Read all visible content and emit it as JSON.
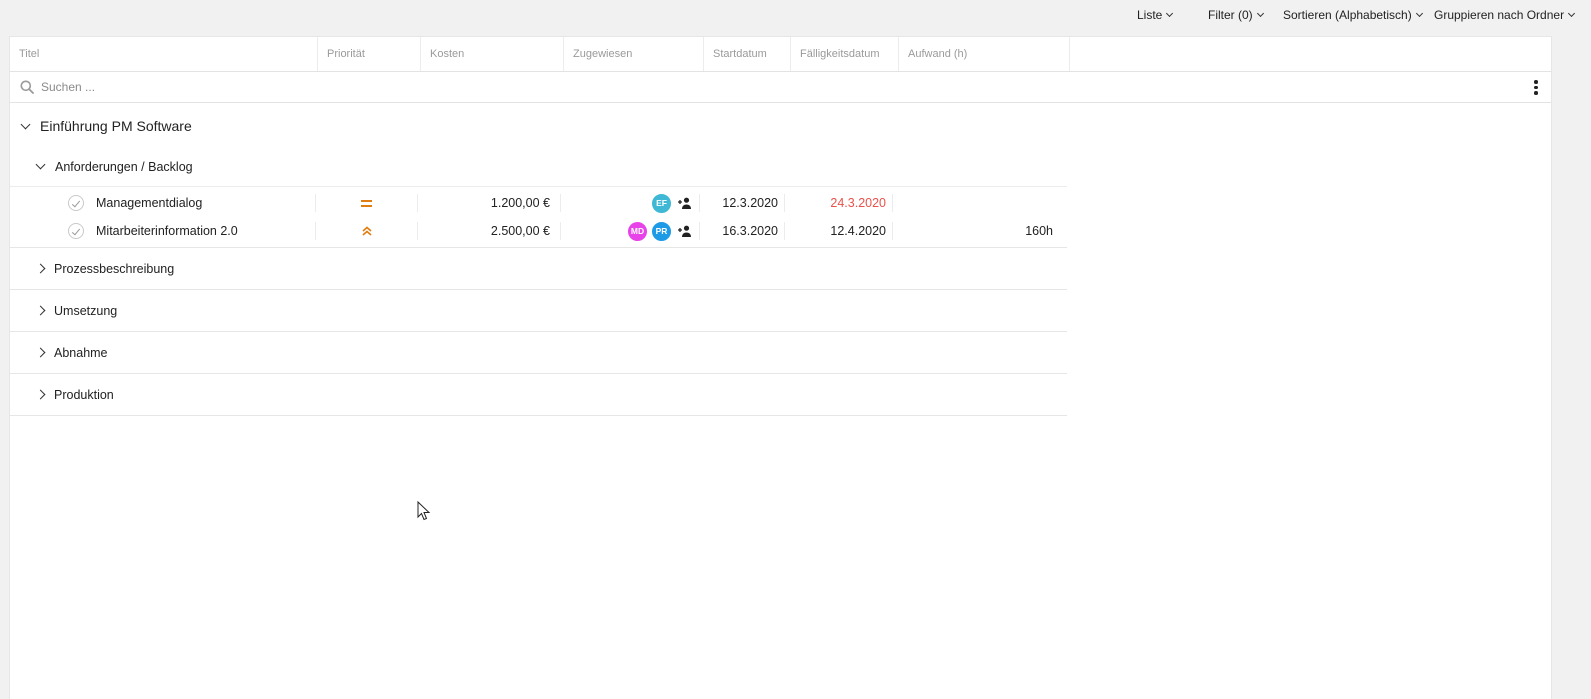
{
  "toolbar": {
    "view_label": "Liste",
    "filter_label": "Filter (0)",
    "sort_label": "Sortieren (Alphabetisch)",
    "group_label": "Gruppieren nach Ordner"
  },
  "columns": [
    "Titel",
    "Priorität",
    "Kosten",
    "Zugewiesen",
    "Startdatum",
    "Fälligkeitsdatum",
    "Aufwand (h)"
  ],
  "search": {
    "placeholder": "Suchen ..."
  },
  "project": {
    "name": "Einführung PM Software"
  },
  "folders": [
    {
      "name": "Anforderungen / Backlog",
      "expanded": true,
      "tasks": [
        {
          "title": "Managementdialog",
          "priority": "medium",
          "cost": "1.200,00 €",
          "assignees": [
            {
              "initials": "EF",
              "color": "#3fb8d6"
            }
          ],
          "start": "12.3.2020",
          "due": "24.3.2020",
          "due_color": "#e8524a",
          "effort": ""
        },
        {
          "title": "Mitarbeiterinformation 2.0",
          "priority": "high",
          "cost": "2.500,00 €",
          "assignees": [
            {
              "initials": "MD",
              "color": "#e843e8"
            },
            {
              "initials": "PR",
              "color": "#1e9be6"
            }
          ],
          "start": "16.3.2020",
          "due": "12.4.2020",
          "due_color": "#222222",
          "effort": "160h"
        }
      ]
    },
    {
      "name": "Prozessbeschreibung",
      "expanded": false
    },
    {
      "name": "Umsetzung",
      "expanded": false
    },
    {
      "name": "Abnahme",
      "expanded": false
    },
    {
      "name": "Produktion",
      "expanded": false
    }
  ],
  "colors": {
    "priority": "#e07d10",
    "overdue": "#e8524a"
  }
}
